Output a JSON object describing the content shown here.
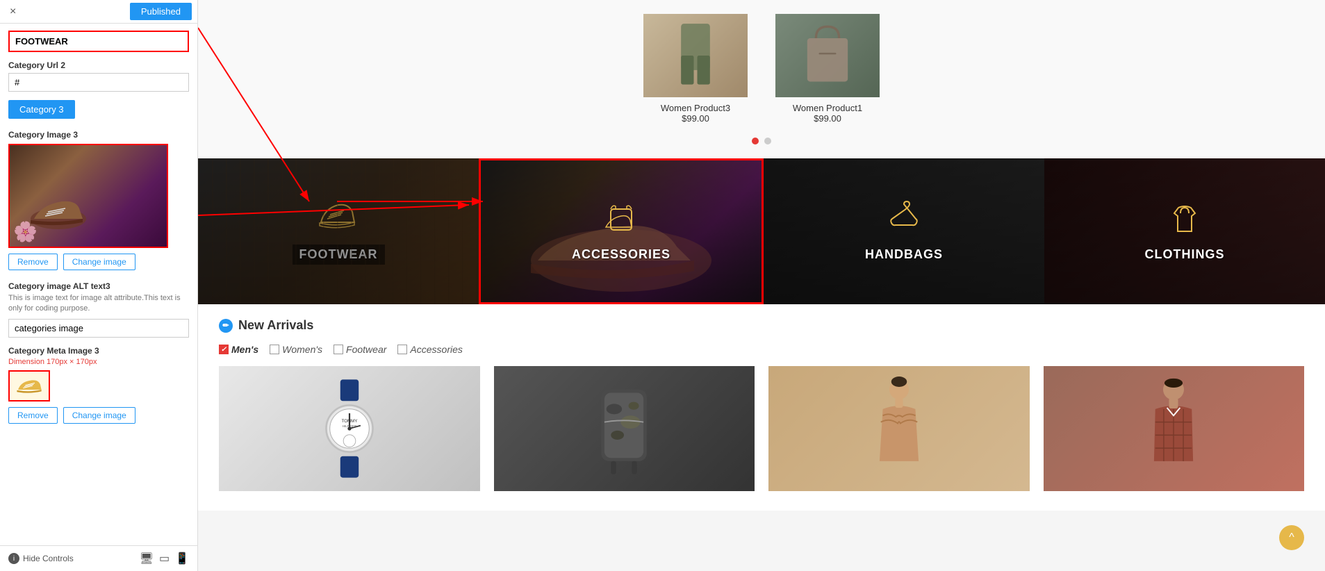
{
  "header": {
    "close_label": "×",
    "published_label": "Published"
  },
  "left_panel": {
    "footwear_value": "FOOTWEAR",
    "category_url_label": "Category Url 2",
    "category_url_value": "#",
    "category_btn_label": "Category 3",
    "category_image_label": "Category Image 3",
    "remove_label": "Remove",
    "change_image_label": "Change image",
    "alt_text_label": "Category image ALT text3",
    "alt_text_hint": "This is image text for image alt attribute.This text is only for coding purpose.",
    "alt_text_value": "categories image",
    "meta_image_label": "Category Meta Image 3",
    "meta_dim_hint": "Dimension 170px × 170px",
    "remove2_label": "Remove",
    "change_image2_label": "Change image",
    "hide_controls_label": "Hide Controls"
  },
  "products_carousel": {
    "product1_name": "Women Product3",
    "product1_price": "$99.00",
    "product2_name": "Women Product1",
    "product2_price": "$99.00"
  },
  "categories": {
    "footwear_label": "FOOTWEAR",
    "accessories_label": "ACCESSORIES",
    "handbags_label": "HANDBAGS",
    "clothings_label": "CLOTHINGS"
  },
  "new_arrivals": {
    "title": "New Arrivals",
    "tabs": [
      {
        "label": "Men's",
        "active": true
      },
      {
        "label": "Women's",
        "active": false
      },
      {
        "label": "Footwear",
        "active": false
      },
      {
        "label": "Accessories",
        "active": false
      }
    ]
  },
  "icons": {
    "shoe": "👟",
    "hanger": "🪝",
    "bag": "👜",
    "pencil": "✏",
    "arrow_up": "^"
  }
}
